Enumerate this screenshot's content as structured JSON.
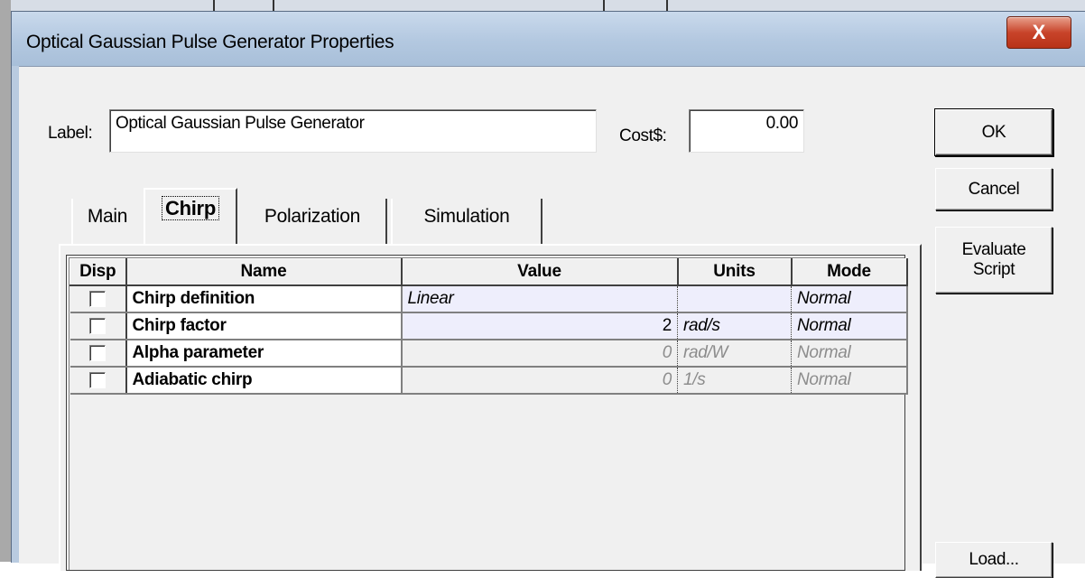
{
  "window": {
    "title": "Optical Gaussian Pulse Generator Properties",
    "close_label": "X"
  },
  "form": {
    "label_caption": "Label:",
    "label_value": "Optical Gaussian Pulse Generator",
    "cost_caption": "Cost$:",
    "cost_value": "0.00"
  },
  "buttons": {
    "ok": "OK",
    "cancel": "Cancel",
    "evaluate_line1": "Evaluate",
    "evaluate_line2": "Script",
    "load": "Load..."
  },
  "tabs": [
    {
      "label": "Main",
      "active": false
    },
    {
      "label": "Chirp",
      "active": true
    },
    {
      "label": "Polarization",
      "active": false
    },
    {
      "label": "Simulation",
      "active": false
    }
  ],
  "table": {
    "headers": {
      "disp": "Disp",
      "name": "Name",
      "value": "Value",
      "units": "Units",
      "mode": "Mode"
    },
    "rows": [
      {
        "disp": false,
        "name": "Chirp definition",
        "value": "Linear",
        "units": "",
        "mode": "Normal",
        "enabled": true
      },
      {
        "disp": false,
        "name": "Chirp factor",
        "value": "2",
        "units": "rad/s",
        "mode": "Normal",
        "enabled": true
      },
      {
        "disp": false,
        "name": "Alpha parameter",
        "value": "0",
        "units": "rad/W",
        "mode": "Normal",
        "enabled": false
      },
      {
        "disp": false,
        "name": "Adiabatic chirp",
        "value": "0",
        "units": "1/s",
        "mode": "Normal",
        "enabled": false
      }
    ]
  }
}
